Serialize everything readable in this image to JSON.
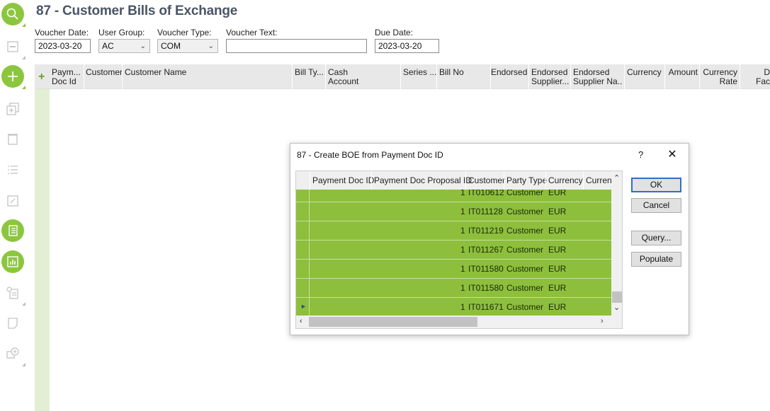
{
  "page": {
    "title": "87 - Customer Bills of Exchange"
  },
  "toolbar": {
    "items": [
      {
        "icon": "search-icon",
        "active": true
      },
      {
        "icon": "save-icon",
        "active": false
      },
      {
        "icon": "add-icon",
        "active": true
      },
      {
        "icon": "duplicate-icon",
        "active": false
      },
      {
        "icon": "delete-icon",
        "active": false
      },
      {
        "icon": "list-icon",
        "active": false
      },
      {
        "icon": "expand-icon",
        "active": false
      },
      {
        "icon": "document-list-icon",
        "active": true
      },
      {
        "icon": "report-chart-icon",
        "active": true
      },
      {
        "icon": "info-document-icon",
        "active": false
      },
      {
        "icon": "note-icon",
        "active": false
      },
      {
        "icon": "discussion-icon",
        "active": false
      }
    ],
    "accent_color": "#8cc63f"
  },
  "form": {
    "voucher_date": {
      "label": "Voucher Date:",
      "value": "2023-03-20"
    },
    "user_group": {
      "label": "User Group:",
      "value": "AC"
    },
    "voucher_type": {
      "label": "Voucher Type:",
      "value": "COM"
    },
    "voucher_text": {
      "label": "Voucher Text:",
      "value": ""
    },
    "due_date": {
      "label": "Due Date:",
      "value": "2023-03-20"
    }
  },
  "grid": {
    "columns": [
      {
        "l1": "Paym...",
        "l2": "Doc Id"
      },
      {
        "l1": "Customer",
        "l2": ""
      },
      {
        "l1": "Customer Name",
        "l2": ""
      },
      {
        "l1": "Bill Ty...",
        "l2": ""
      },
      {
        "l1": "Cash",
        "l2": "Account"
      },
      {
        "l1": "Series ...",
        "l2": ""
      },
      {
        "l1": "Bill No",
        "l2": ""
      },
      {
        "l1": "Endorsed",
        "l2": ""
      },
      {
        "l1": "Endorsed",
        "l2": "Supplier..."
      },
      {
        "l1": "Endorsed",
        "l2": "Supplier Na..."
      },
      {
        "l1": "Currency",
        "l2": ""
      },
      {
        "l1": "Amount",
        "l2": ""
      },
      {
        "l1": "Currency",
        "l2": "Rate"
      },
      {
        "l1": "D",
        "l2": "Fac"
      }
    ]
  },
  "dialog": {
    "title": "87 - Create BOE from Payment Doc ID",
    "help": "?",
    "close": "✕",
    "columns": [
      "Payment Doc ID",
      "Payment Doc Proposal ID",
      "Customer",
      "Party Type",
      "Currency",
      "Curren"
    ],
    "rows": [
      {
        "proposal_id": "1",
        "customer": "IT010612",
        "party_type": "Customer",
        "currency": "EUR",
        "current": false
      },
      {
        "proposal_id": "1",
        "customer": "IT011128",
        "party_type": "Customer",
        "currency": "EUR",
        "current": false
      },
      {
        "proposal_id": "1",
        "customer": "IT011219",
        "party_type": "Customer",
        "currency": "EUR",
        "current": false
      },
      {
        "proposal_id": "1",
        "customer": "IT011267",
        "party_type": "Customer",
        "currency": "EUR",
        "current": false
      },
      {
        "proposal_id": "1",
        "customer": "IT011580",
        "party_type": "Customer",
        "currency": "EUR",
        "current": false
      },
      {
        "proposal_id": "1",
        "customer": "IT011580",
        "party_type": "Customer",
        "currency": "EUR",
        "current": false
      },
      {
        "proposal_id": "1",
        "customer": "IT011671",
        "party_type": "Customer",
        "currency": "EUR",
        "current": true
      }
    ],
    "buttons": {
      "ok": "OK",
      "cancel": "Cancel",
      "query": "Query...",
      "populate": "Populate"
    },
    "row_color": "#8dbf3c"
  }
}
